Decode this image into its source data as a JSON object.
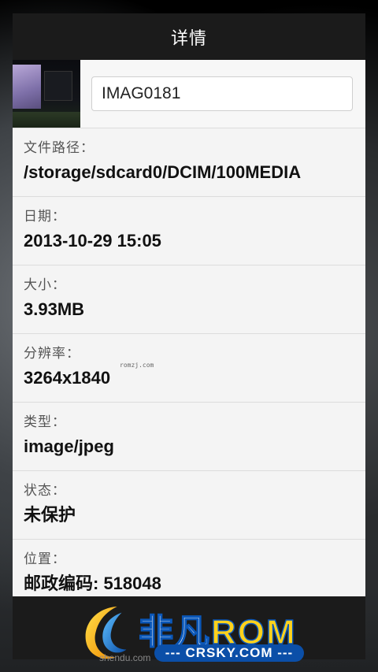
{
  "dialog": {
    "title": "详情",
    "file_name": "IMAG0181",
    "details": [
      {
        "label": "文件路径：",
        "value": "/storage/sdcard0/DCIM/100MEDIA"
      },
      {
        "label": "日期：",
        "value": "2013-10-29 15:05"
      },
      {
        "label": "大小：",
        "value": "3.93MB"
      },
      {
        "label": "分辨率：",
        "value": "3264x1840"
      },
      {
        "label": "类型：",
        "value": "image/jpeg"
      },
      {
        "label": "状态：",
        "value": "未保护"
      },
      {
        "label": "位置：",
        "value": "邮政编码: 518048"
      }
    ]
  },
  "watermark": {
    "small_text": "romzj.com",
    "logo_main": "非凡",
    "logo_rom": "ROM",
    "logo_sub": "--- CRSKY.COM ---",
    "logo_under": "shendu.com"
  }
}
